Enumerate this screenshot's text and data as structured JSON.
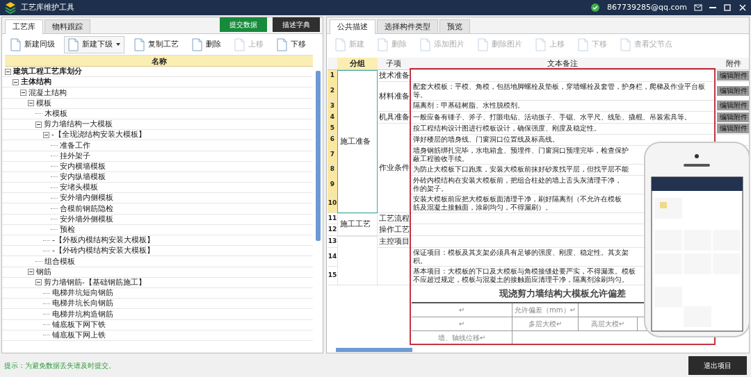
{
  "window": {
    "title": "工艺库维护工具",
    "account": "867739285@qq.com"
  },
  "left_panel": {
    "tabs": [
      {
        "label": "工艺库",
        "selected": true
      },
      {
        "label": "物料跟踪",
        "selected": false
      }
    ],
    "actions": [
      {
        "label": "提交数据",
        "kind": "primary"
      },
      {
        "label": "描述字典",
        "kind": "dark"
      }
    ],
    "toolbar": [
      {
        "label": "新建同级",
        "disabled": false,
        "dropdown": false
      },
      {
        "label": "新建下级",
        "disabled": false,
        "dropdown": true
      },
      {
        "label": "复制工艺",
        "disabled": false,
        "dropdown": false
      },
      {
        "label": "删除",
        "disabled": false,
        "dropdown": false
      },
      {
        "label": "上移",
        "disabled": true,
        "dropdown": false
      },
      {
        "label": "下移",
        "disabled": false,
        "dropdown": false
      }
    ],
    "tree_header": "名称",
    "tree": [
      {
        "label": "建筑工程工艺库划分",
        "expanded": true,
        "children": [
          {
            "label": "主体结构",
            "expanded": true,
            "children": [
              {
                "label": "混凝土结构",
                "expanded": true,
                "children": [
                  {
                    "label": "模板",
                    "expanded": true,
                    "children": [
                      {
                        "label": "木模板"
                      },
                      {
                        "label": "剪力墙结构一大模板",
                        "expanded": true,
                        "children": [
                          {
                            "label": "-【全现浇结构安装大模板】",
                            "expanded": true,
                            "children": [
                              {
                                "label": "准备工作"
                              },
                              {
                                "label": "挂外架子"
                              },
                              {
                                "label": "安内横墙模板"
                              },
                              {
                                "label": "安内纵墙模板"
                              },
                              {
                                "label": "安堵头模板"
                              },
                              {
                                "label": "安外墙内侧模板"
                              },
                              {
                                "label": "合模前钢筋隐检"
                              },
                              {
                                "label": "安外墙外侧模板"
                              },
                              {
                                "label": "预检"
                              }
                            ]
                          },
                          {
                            "label": "-【外板内模结构安装大模板】"
                          },
                          {
                            "label": "-【外砖内模结构安装大模板】"
                          }
                        ]
                      },
                      {
                        "label": "组合模板"
                      }
                    ]
                  },
                  {
                    "label": "钢筋",
                    "expanded": true,
                    "children": [
                      {
                        "label": "剪力墙钢筋-【基础钢筋施工】",
                        "expanded": true,
                        "children": [
                          {
                            "label": "电梯井坑短向钢筋"
                          },
                          {
                            "label": "电梯井坑长向钢筋"
                          },
                          {
                            "label": "电梯井坑构造钢筋"
                          },
                          {
                            "label": "铺底板下网下铁"
                          },
                          {
                            "label": "铺底板下网上铁"
                          }
                        ]
                      }
                    ]
                  }
                ]
              }
            ]
          }
        ]
      }
    ]
  },
  "right_panel": {
    "tabs": [
      {
        "label": "公共描述",
        "selected": true
      },
      {
        "label": "选择构件类型",
        "selected": false
      },
      {
        "label": "预览",
        "selected": false
      }
    ],
    "toolbar": [
      {
        "label": "新建",
        "disabled": true
      },
      {
        "label": "删除",
        "disabled": true
      },
      {
        "label": "添加图片",
        "disabled": true
      },
      {
        "label": "删除图片",
        "disabled": true
      },
      {
        "label": "上移",
        "disabled": true
      },
      {
        "label": "下移",
        "disabled": true
      },
      {
        "label": "查看父节点",
        "disabled": true
      }
    ],
    "columns": [
      "分组",
      "子项",
      "文本备注",
      "附件"
    ],
    "groups": [
      {
        "label": "施工准备",
        "selected": true,
        "subitems": [
          {
            "label": "技术准备",
            "rows": [
              {
                "num": "1",
                "selected": true,
                "lines": [],
                "attachment": "编辑附件"
              }
            ]
          },
          {
            "label": "材料准备",
            "rows": [
              {
                "num": "2",
                "selected": true,
                "lines": [
                  "配套大模板：平模、角模，包括地脚螺栓及垫板，穿墙螺栓及套管，护身栏，爬梯及作业平台板",
                  "等。"
                ],
                "attachment": "编辑附件"
              },
              {
                "num": "3",
                "selected": true,
                "lines": [
                  "隔离剂：甲基硅树脂、水性脱模剂。"
                ],
                "attachment": "编辑附件"
              }
            ]
          },
          {
            "label": "机具准备",
            "rows": [
              {
                "num": "4",
                "selected": true,
                "lines": [
                  "一般应备有锤子、斧子、打眼电钻、活动扳子、手锯、水平尺、线坠、撬棍、吊装索具等。"
                ],
                "attachment": "编辑附件"
              }
            ]
          },
          {
            "label": "作业条件",
            "rows": [
              {
                "num": "5",
                "selected": true,
                "lines": [
                  "按工程结构设计图进行模板设计，确保强度、刚度及稳定性。"
                ],
                "attachment": "编辑附件"
              },
              {
                "num": "6",
                "selected": true,
                "lines": [
                  "弹好楼层的墙身线、门窗洞口位置线及标高线。"
                ]
              },
              {
                "num": "7",
                "selected": true,
                "lines": [
                  "墙身钢筋绑扎完毕，水电箱盒、预埋件、门窗洞口预埋完毕，检查保护",
                  "蔽工程验收手续。"
                ]
              },
              {
                "num": "8",
                "selected": true,
                "lines": [
                  "为防止大模板下口跑浆，安装大模板前抹好砂浆找平层，但找平层不能"
                ]
              },
              {
                "num": "9",
                "selected": true,
                "lines": [
                  "外砖内模结构在安装大模板前，把组合柱处的墙上舌头灰清理干净，",
                  "作的架子。"
                ]
              },
              {
                "num": "10",
                "selected": true,
                "lines": [
                  "安装大模板前应把大模板板面清理干净，刷好隔离剂（不允许在模板",
                  "筋及混凝土接触面，涂刷均匀，不得漏刷）。"
                ]
              }
            ]
          }
        ]
      },
      {
        "label": "施工工艺",
        "selected": false,
        "subitems": [
          {
            "label": "工艺流程",
            "rows": [
              {
                "num": "11",
                "selected": false,
                "lines": []
              }
            ]
          },
          {
            "label": "操作工艺",
            "rows": [
              {
                "num": "12",
                "selected": false,
                "lines": []
              }
            ]
          }
        ]
      },
      {
        "selected": false,
        "subitems": [
          {
            "label": "主控项目",
            "rows": [
              {
                "num": "13",
                "selected": false,
                "lines": []
              }
            ]
          },
          {
            "rows": [
              {
                "num": "14",
                "selected": false,
                "lines": [
                  "保证项目：模板及其支架必须具有足够的强度、刚度、稳定性。其支架",
                  "积。"
                ]
              },
              {
                "num": "15",
                "selected": false,
                "lines": [
                  "基本项目：大模板的下口及大模板与角模接缝处要严实，不得漏浆。模板",
                  "不应超过规定，模板与混凝土的接触面应清理干净，隔离剂涂刷均匀。"
                ]
              }
            ]
          }
        ]
      }
    ],
    "deviation_table": {
      "title": "现浇剪力墙结构大模板允许偏差",
      "rows": [
        [
          "↵",
          "允许偏差（mm）↵"
        ],
        [
          "↵",
          "多层大模↵",
          "高层大模↵"
        ],
        [
          "墙、轴线位移↵"
        ]
      ]
    },
    "phone": {
      "kind": "picture"
    }
  },
  "status_bar": {
    "message": "提示：为避免数据丢失请及时提交。",
    "button": "退出项目"
  }
}
